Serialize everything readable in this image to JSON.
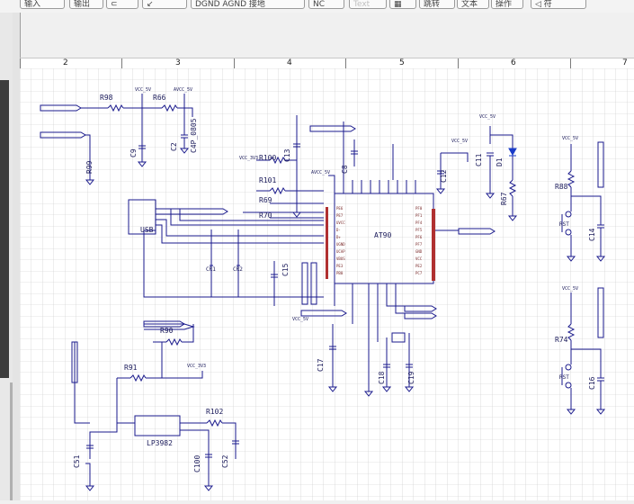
{
  "toolbar": {
    "buttons": [
      "输入",
      "输出",
      "⊂",
      "↙",
      "DGND AGND 接地",
      "NC",
      "Text",
      "▦",
      "跳转",
      "文本",
      "操作",
      "◁ 符"
    ]
  },
  "ruler": {
    "columns": [
      "2",
      "3",
      "4",
      "5",
      "6",
      "7"
    ]
  },
  "schematic": {
    "components": {
      "r98": "R98",
      "r66": "R66",
      "r99": "R99",
      "c9": "C9",
      "c2": "C2",
      "c4p": "C4P_0805",
      "r100": "R100",
      "r101": "R101",
      "r69": "R69",
      "r70": "R70",
      "c13": "C13",
      "c8": "C8",
      "c12": "C12",
      "c11": "C11",
      "d1": "D1",
      "r67": "R67",
      "r88": "R88",
      "c14": "C14",
      "rst": "RST",
      "usb": "USB",
      "cr1": "CR1",
      "cr2": "CR2",
      "c15": "C15",
      "at90": "AT90",
      "r90": "R90",
      "r91": "R91",
      "c17": "C17",
      "c18": "C18",
      "c19": "C19",
      "r74": "R74",
      "c16": "C16",
      "r102": "R102",
      "lp3982": "LP3982",
      "c51": "C51",
      "c100": "C100",
      "c52": "C52"
    },
    "power": {
      "vcc_a": "VCC_5V",
      "vcc_b": "AVCC_5V",
      "vcc_c": "VCC_3V3"
    }
  }
}
